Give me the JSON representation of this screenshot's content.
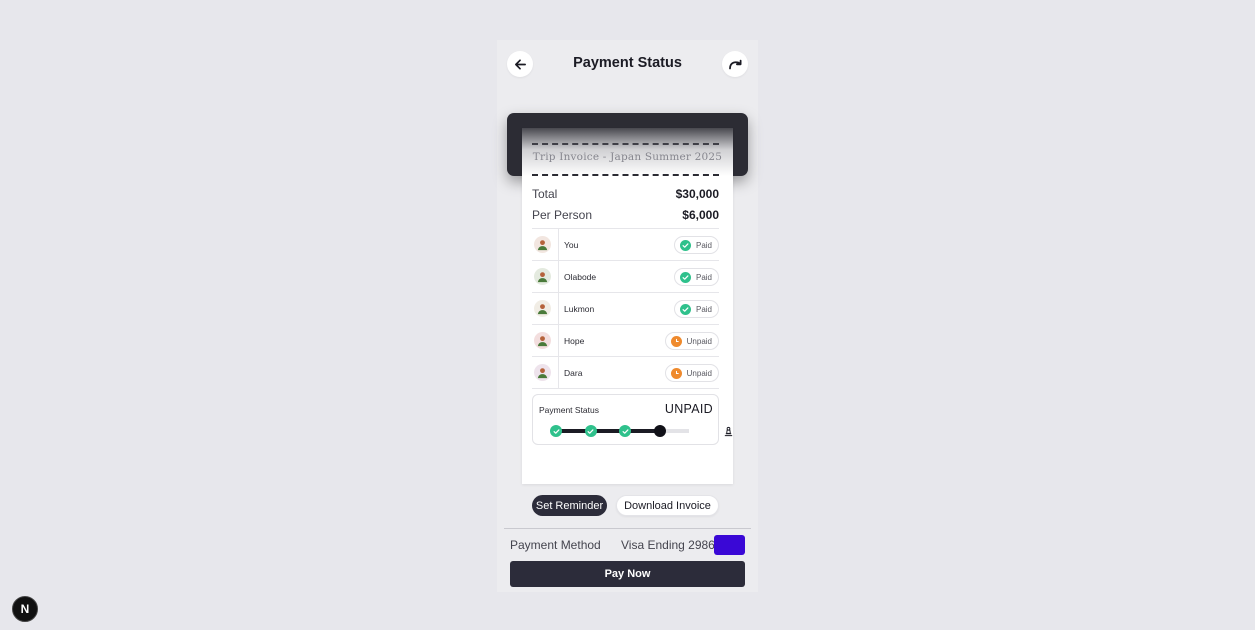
{
  "header": {
    "title": "Payment Status",
    "back_icon": "arrow-left-icon",
    "refresh_icon": "redo-icon"
  },
  "invoice": {
    "title": "Trip Invoice - Japan Summer 2025",
    "total_label": "Total",
    "total_value": "$30,000",
    "per_person_label": "Per Person",
    "per_person_value": "$6,000"
  },
  "members": [
    {
      "name": "You",
      "status": "Paid",
      "avatar_color": "#f2e6e0"
    },
    {
      "name": "Olabode",
      "status": "Paid",
      "avatar_color": "#e4eadf"
    },
    {
      "name": "Lukmon",
      "status": "Paid",
      "avatar_color": "#f1ede5"
    },
    {
      "name": "Hope",
      "status": "Unpaid",
      "avatar_color": "#f3dede"
    },
    {
      "name": "Dara",
      "status": "Unpaid",
      "avatar_color": "#eee3ec"
    }
  ],
  "payment_status": {
    "label": "Payment Status",
    "value": "UNPAID",
    "paid_count": 3,
    "total_count": 5
  },
  "actions": {
    "reminder_label": "Set Reminder",
    "download_label": "Download Invoice"
  },
  "payment_method": {
    "label": "Payment Method",
    "value": "Visa Ending 2986",
    "card_color": "#3a08d6"
  },
  "pay_button": {
    "label": "Pay Now"
  },
  "dev_badge": {
    "label": "N"
  },
  "colors": {
    "paid": "#2fc18c",
    "unpaid": "#ef8a2d",
    "dark": "#2c2c3a"
  }
}
